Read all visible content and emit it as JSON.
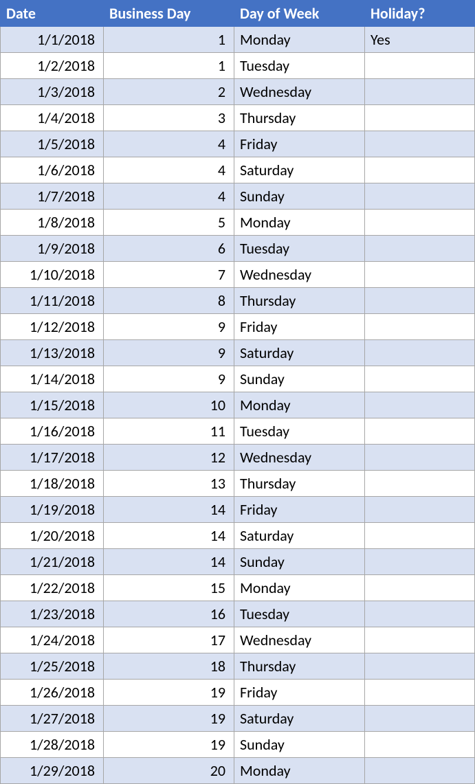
{
  "headers": {
    "date": "Date",
    "business_day": "Business Day",
    "day_of_week": "Day of Week",
    "holiday": "Holiday?"
  },
  "rows": [
    {
      "date": "1/1/2018",
      "business_day": "1",
      "day_of_week": "Monday",
      "holiday": "Yes"
    },
    {
      "date": "1/2/2018",
      "business_day": "1",
      "day_of_week": "Tuesday",
      "holiday": ""
    },
    {
      "date": "1/3/2018",
      "business_day": "2",
      "day_of_week": "Wednesday",
      "holiday": ""
    },
    {
      "date": "1/4/2018",
      "business_day": "3",
      "day_of_week": "Thursday",
      "holiday": ""
    },
    {
      "date": "1/5/2018",
      "business_day": "4",
      "day_of_week": "Friday",
      "holiday": ""
    },
    {
      "date": "1/6/2018",
      "business_day": "4",
      "day_of_week": "Saturday",
      "holiday": ""
    },
    {
      "date": "1/7/2018",
      "business_day": "4",
      "day_of_week": "Sunday",
      "holiday": ""
    },
    {
      "date": "1/8/2018",
      "business_day": "5",
      "day_of_week": "Monday",
      "holiday": ""
    },
    {
      "date": "1/9/2018",
      "business_day": "6",
      "day_of_week": "Tuesday",
      "holiday": ""
    },
    {
      "date": "1/10/2018",
      "business_day": "7",
      "day_of_week": "Wednesday",
      "holiday": ""
    },
    {
      "date": "1/11/2018",
      "business_day": "8",
      "day_of_week": "Thursday",
      "holiday": ""
    },
    {
      "date": "1/12/2018",
      "business_day": "9",
      "day_of_week": "Friday",
      "holiday": ""
    },
    {
      "date": "1/13/2018",
      "business_day": "9",
      "day_of_week": "Saturday",
      "holiday": ""
    },
    {
      "date": "1/14/2018",
      "business_day": "9",
      "day_of_week": "Sunday",
      "holiday": ""
    },
    {
      "date": "1/15/2018",
      "business_day": "10",
      "day_of_week": "Monday",
      "holiday": ""
    },
    {
      "date": "1/16/2018",
      "business_day": "11",
      "day_of_week": "Tuesday",
      "holiday": ""
    },
    {
      "date": "1/17/2018",
      "business_day": "12",
      "day_of_week": "Wednesday",
      "holiday": ""
    },
    {
      "date": "1/18/2018",
      "business_day": "13",
      "day_of_week": "Thursday",
      "holiday": ""
    },
    {
      "date": "1/19/2018",
      "business_day": "14",
      "day_of_week": "Friday",
      "holiday": ""
    },
    {
      "date": "1/20/2018",
      "business_day": "14",
      "day_of_week": "Saturday",
      "holiday": ""
    },
    {
      "date": "1/21/2018",
      "business_day": "14",
      "day_of_week": "Sunday",
      "holiday": ""
    },
    {
      "date": "1/22/2018",
      "business_day": "15",
      "day_of_week": "Monday",
      "holiday": ""
    },
    {
      "date": "1/23/2018",
      "business_day": "16",
      "day_of_week": "Tuesday",
      "holiday": ""
    },
    {
      "date": "1/24/2018",
      "business_day": "17",
      "day_of_week": "Wednesday",
      "holiday": ""
    },
    {
      "date": "1/25/2018",
      "business_day": "18",
      "day_of_week": "Thursday",
      "holiday": ""
    },
    {
      "date": "1/26/2018",
      "business_day": "19",
      "day_of_week": "Friday",
      "holiday": ""
    },
    {
      "date": "1/27/2018",
      "business_day": "19",
      "day_of_week": "Saturday",
      "holiday": ""
    },
    {
      "date": "1/28/2018",
      "business_day": "19",
      "day_of_week": "Sunday",
      "holiday": ""
    },
    {
      "date": "1/29/2018",
      "business_day": "20",
      "day_of_week": "Monday",
      "holiday": ""
    }
  ]
}
